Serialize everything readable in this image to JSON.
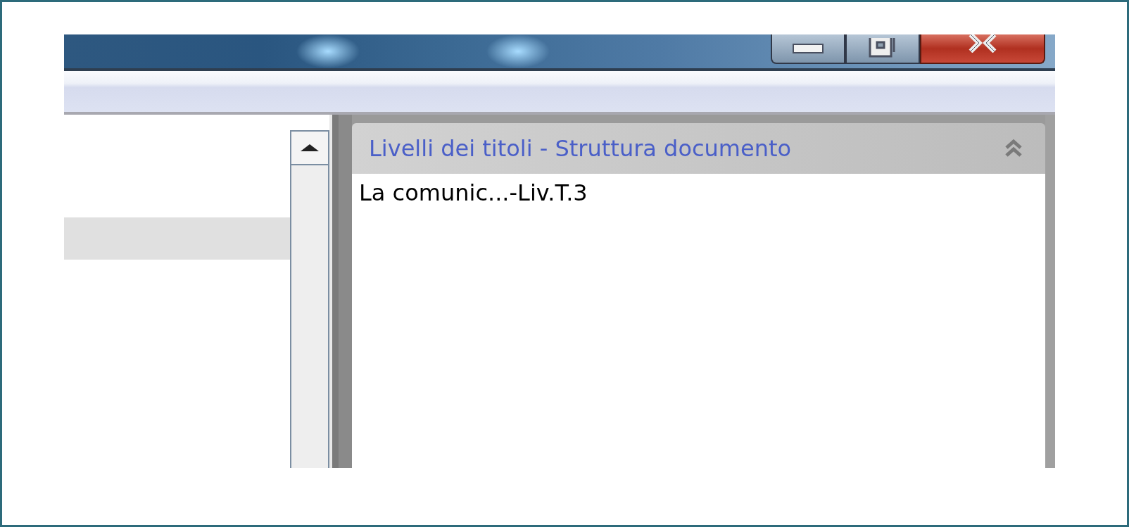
{
  "panel": {
    "title": "Livelli dei titoli - Struttura documento"
  },
  "outline": {
    "items": [
      {
        "label": "La comunic...-Liv.T.3"
      }
    ]
  }
}
